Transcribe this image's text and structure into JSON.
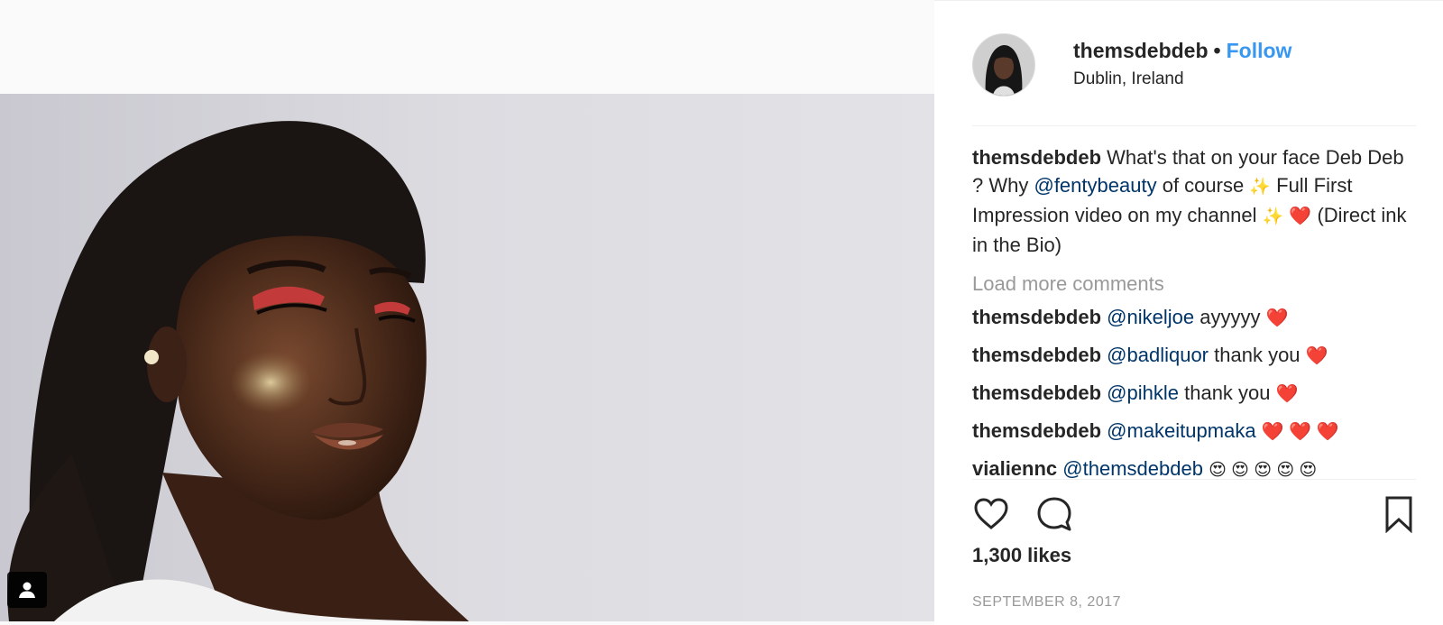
{
  "post": {
    "username": "themsdebdeb",
    "separator": "•",
    "follow_label": "Follow",
    "location": "Dublin, Ireland",
    "caption": {
      "username": "themsdebdeb",
      "text_1": "What's that on your face Deb Deb ? Why",
      "mention": "@fentybeauty",
      "text_2": "of course",
      "sparkle_1": "✨",
      "text_3": "Full First Impression video on my channel",
      "sparkle_2": "✨",
      "heart": "❤️",
      "text_4": "(Direct ink in the Bio)"
    },
    "load_more_label": "Load more comments",
    "comments": [
      {
        "username": "themsdebdeb",
        "mention": "@nikeljoe",
        "text": "ayyyyy",
        "emoji": "❤️"
      },
      {
        "username": "themsdebdeb",
        "mention": "@badliquor",
        "text": "thank you",
        "emoji": "❤️"
      },
      {
        "username": "themsdebdeb",
        "mention": "@pihkle",
        "text": "thank you",
        "emoji": "❤️"
      },
      {
        "username": "themsdebdeb",
        "mention": "@makeitupmaka",
        "text": "",
        "emoji": "❤️ ❤️ ❤️"
      },
      {
        "username": "vialiennc",
        "mention": "@themsdebdeb",
        "text": "",
        "emoji": "😍 😍 😍 😍 😍"
      }
    ],
    "likes": "1,300 likes",
    "date": "SEPTEMBER 8, 2017"
  },
  "icons": {
    "like": "heart-outline-icon",
    "comment": "speech-bubble-icon",
    "save": "bookmark-icon",
    "tag": "person-tag-icon"
  },
  "colors": {
    "link_blue": "#3897f0",
    "mention_blue": "#003569",
    "text_dark": "#262626",
    "text_muted": "#999999"
  }
}
